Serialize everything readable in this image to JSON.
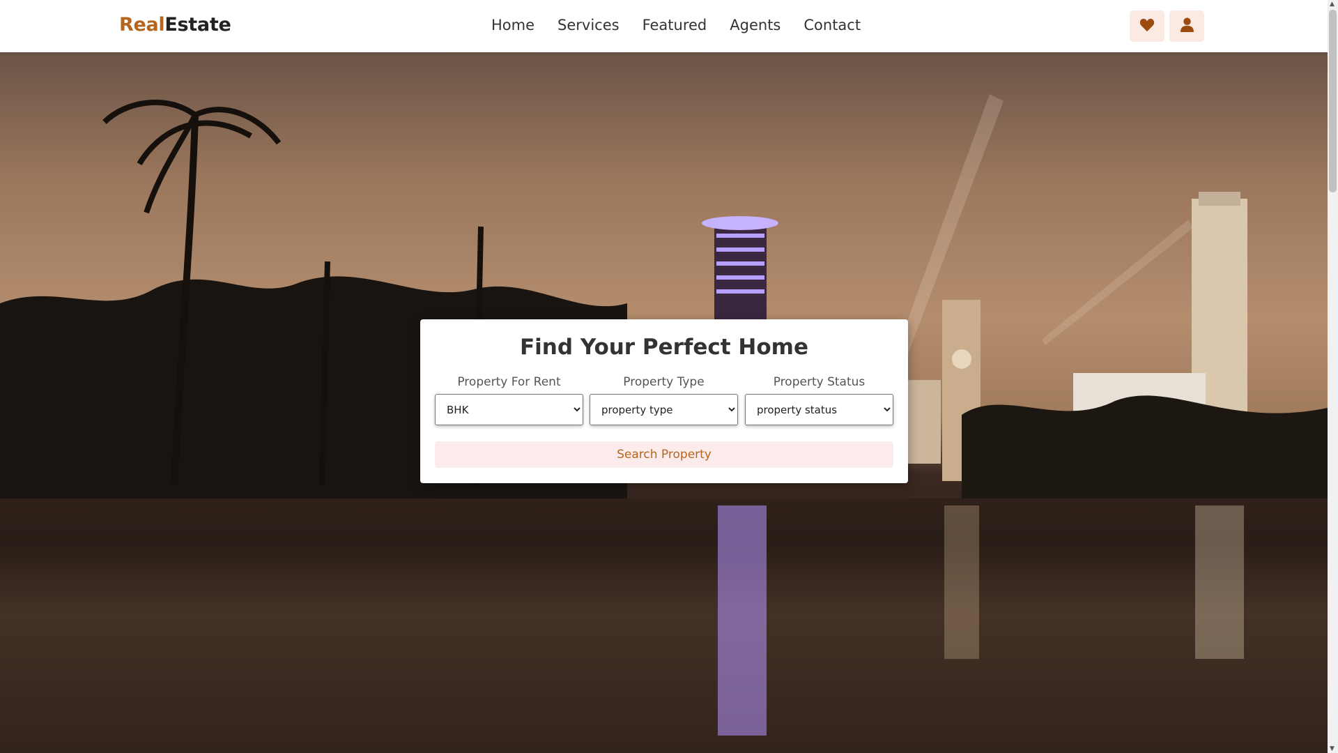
{
  "brand": {
    "part1": "Real",
    "part2": "Estate",
    "accent_color": "#b5651d"
  },
  "nav": [
    {
      "label": "Home"
    },
    {
      "label": "Services"
    },
    {
      "label": "Featured"
    },
    {
      "label": "Agents"
    },
    {
      "label": "Contact"
    }
  ],
  "header_icons": {
    "favorites": "heart-icon",
    "account": "user-icon"
  },
  "search": {
    "title": "Find Your Perfect Home",
    "fields": [
      {
        "label": "Property For Rent",
        "value": "BHK"
      },
      {
        "label": "Property Type",
        "value": "property type"
      },
      {
        "label": "Property Status",
        "value": "property status"
      }
    ],
    "button_label": "Search Property"
  }
}
